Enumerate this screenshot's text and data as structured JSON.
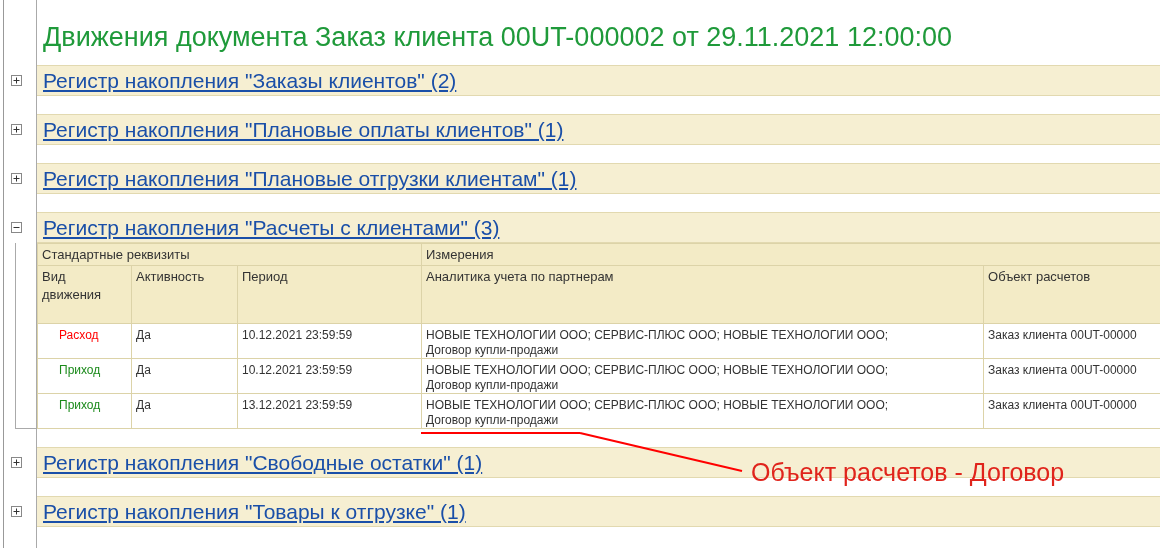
{
  "title": "Движения документа Заказ клиента 00UT-000002 от 29.11.2021 12:00:00",
  "sections": [
    {
      "label": "Регистр накопления \"Заказы клиентов\" (2)",
      "expanded": false
    },
    {
      "label": "Регистр накопления \"Плановые оплаты клиентов\" (1)",
      "expanded": false
    },
    {
      "label": "Регистр накопления \"Плановые отгрузки клиентам\" (1)",
      "expanded": false
    },
    {
      "label": "Регистр накопления \"Расчеты с клиентами\" (3)",
      "expanded": true,
      "table": {
        "groups": [
          {
            "label": "Стандартные реквизиты"
          },
          {
            "label": "Измерения"
          }
        ],
        "columns": [
          "Вид движения",
          "Активность",
          "Период",
          "Аналитика учета по партнерам",
          "Объект расчетов"
        ],
        "rows": [
          {
            "movement": {
              "text": "Расход",
              "kind": "expense"
            },
            "active": "Да",
            "period": "10.12.2021 23:59:59",
            "analytics": [
              "НОВЫЕ ТЕХНОЛОГИИ ООО; СЕРВИС-ПЛЮС ООО; НОВЫЕ ТЕХНОЛОГИИ ООО;",
              "Договор купли-продажи"
            ],
            "object": "Заказ клиента 00UT-00000"
          },
          {
            "movement": {
              "text": "Приход",
              "kind": "income"
            },
            "active": "Да",
            "period": "10.12.2021 23:59:59",
            "analytics": [
              "НОВЫЕ ТЕХНОЛОГИИ ООО; СЕРВИС-ПЛЮС ООО; НОВЫЕ ТЕХНОЛОГИИ ООО;",
              "Договор купли-продажи"
            ],
            "object": "Заказ клиента 00UT-00000"
          },
          {
            "movement": {
              "text": "Приход",
              "kind": "income"
            },
            "active": "Да",
            "period": "13.12.2021 23:59:59",
            "analytics": [
              "НОВЫЕ ТЕХНОЛОГИИ ООО; СЕРВИС-ПЛЮС ООО; НОВЫЕ ТЕХНОЛОГИИ ООО;",
              "Договор купли-продажи"
            ],
            "object": "Заказ клиента 00UT-00000"
          }
        ]
      }
    },
    {
      "label": "Регистр накопления \"Свободные остатки\" (1)",
      "expanded": false
    },
    {
      "label": "Регистр накопления \"Товары к отгрузке\" (1)",
      "expanded": false
    }
  ],
  "annotation": {
    "text": "Объект расчетов - Договор"
  }
}
